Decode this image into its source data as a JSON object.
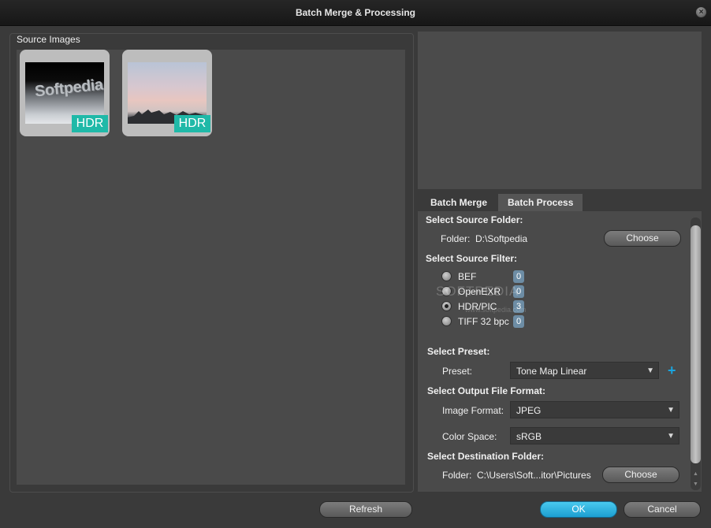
{
  "window": {
    "title": "Batch Merge & Processing",
    "close_glyph": "×"
  },
  "source": {
    "label": "Source Images",
    "thumbnails": [
      {
        "badge": "HDR",
        "watermark": "Softpedia"
      },
      {
        "badge": "HDR"
      }
    ]
  },
  "tabs": [
    {
      "label": "Batch Merge",
      "active": false
    },
    {
      "label": "Batch Process",
      "active": true
    }
  ],
  "process": {
    "source_folder": {
      "heading": "Select Source Folder:",
      "label": "Folder:",
      "path": "D:\\Softpedia",
      "choose_label": "Choose"
    },
    "source_filter": {
      "heading": "Select Source Filter:",
      "options": [
        {
          "label": "BEF",
          "count": "0",
          "selected": false
        },
        {
          "label": "OpenEXR",
          "count": "0",
          "selected": false
        },
        {
          "label": "HDR/PIC",
          "count": "3",
          "selected": true
        },
        {
          "label": "TIFF 32 bpc",
          "count": "0",
          "selected": false
        }
      ]
    },
    "preset": {
      "heading": "Select Preset:",
      "label": "Preset:",
      "value": "Tone Map Linear",
      "add_glyph": "+"
    },
    "output_format": {
      "heading": "Select Output File Format:",
      "format_label": "Image Format:",
      "format_value": "JPEG",
      "colorspace_label": "Color Space:",
      "colorspace_value": "sRGB"
    },
    "destination": {
      "heading": "Select Destination Folder:",
      "label": "Folder:",
      "path": "C:\\Users\\Soft...itor\\Pictures",
      "choose_label": "Choose"
    }
  },
  "watermark": {
    "main": "SOFTPEDIA",
    "sub": "www.softpedia.com"
  },
  "footer": {
    "refresh_label": "Refresh",
    "ok_label": "OK",
    "cancel_label": "Cancel"
  },
  "scroll": {
    "up_glyph": "▲",
    "down_glyph": "▼"
  },
  "colors": {
    "accent": "#1c9fd1",
    "hdr_badge": "#1fb9a8",
    "count_badge": "#6d8da5"
  }
}
